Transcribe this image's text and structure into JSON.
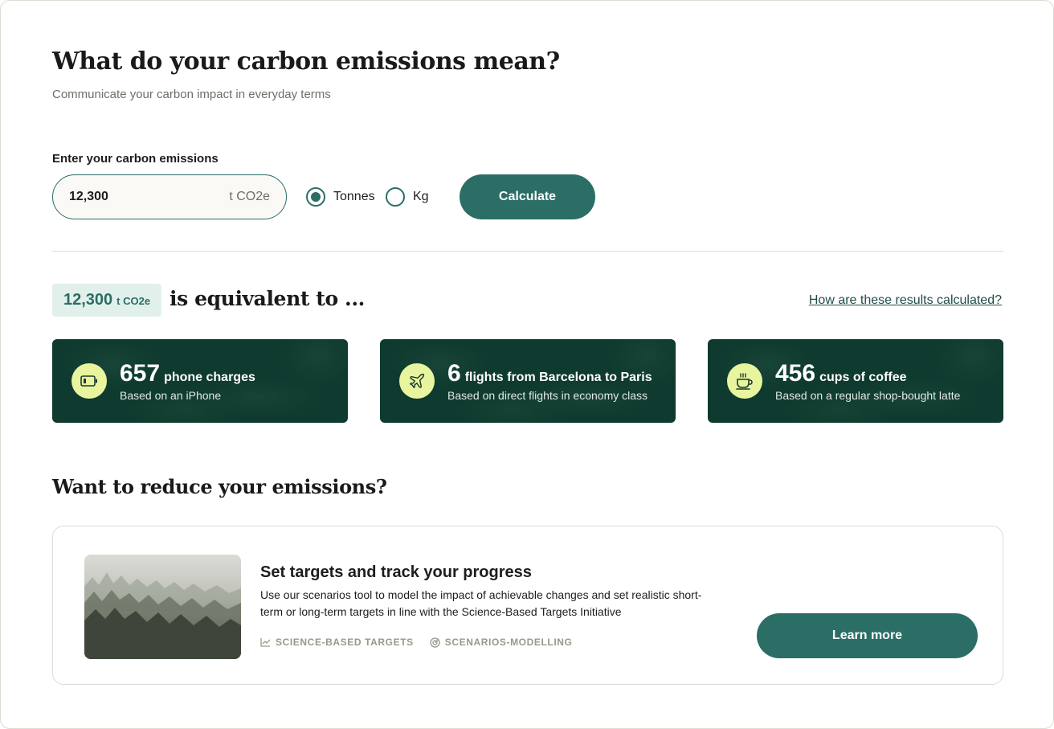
{
  "header": {
    "title": "What do your carbon emissions mean?",
    "subtitle": "Communicate your carbon impact in everyday terms"
  },
  "form": {
    "label": "Enter your carbon emissions",
    "input_value": "12,300",
    "input_unit": "t CO2e",
    "unit_options": [
      {
        "label": "Tonnes",
        "selected": true
      },
      {
        "label": "Kg",
        "selected": false
      }
    ],
    "calculate_label": "Calculate"
  },
  "results": {
    "badge_value": "12,300",
    "badge_unit": "t CO2e",
    "heading": "is equivalent to ...",
    "how_link": "How are these results calculated?",
    "cards": [
      {
        "icon": "battery-icon",
        "number": "657",
        "label": "phone charges",
        "sub": "Based on an iPhone"
      },
      {
        "icon": "airplane-icon",
        "number": "6",
        "label": "flights from Barcelona to Paris",
        "sub": "Based on direct flights in economy class"
      },
      {
        "icon": "coffee-cup-icon",
        "number": "456",
        "label": "cups of coffee",
        "sub": "Based on a regular shop-bought latte"
      }
    ]
  },
  "reduce": {
    "heading": "Want to reduce your emissions?",
    "promo": {
      "title": "Set targets and track your progress",
      "description": "Use our scenarios tool to model the impact of achievable changes and set realistic short-term or long-term targets in line with the Science-Based Targets Initiative",
      "tags": [
        {
          "icon": "chart-icon",
          "label": "SCIENCE-BASED TARGETS"
        },
        {
          "icon": "target-icon",
          "label": "SCENARIOS-MODELLING"
        }
      ],
      "cta": "Learn more"
    }
  },
  "colors": {
    "primary": "#2a6e66",
    "card_bg": "#0f3a2f",
    "icon_bg": "#e8f59e",
    "badge_bg": "#e2f0ec"
  }
}
